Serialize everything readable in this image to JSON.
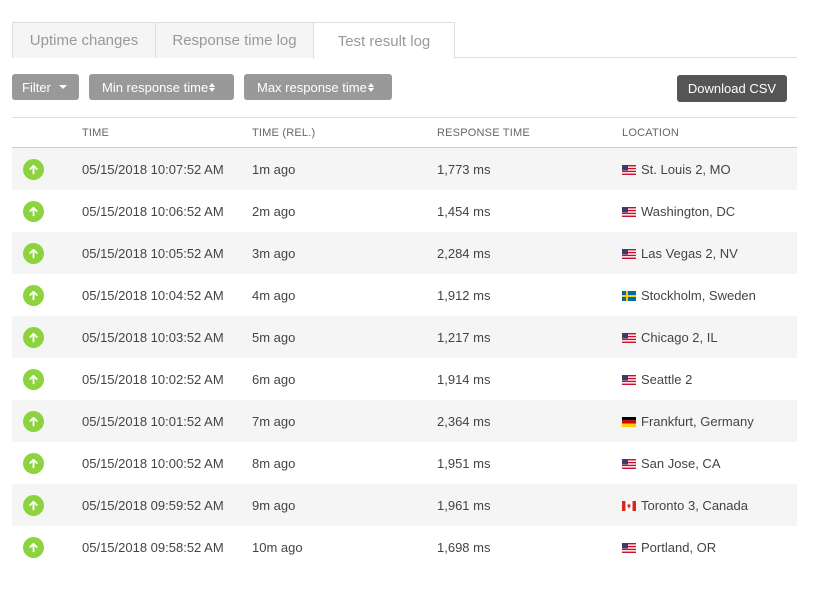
{
  "tabs": [
    {
      "label": "Uptime changes"
    },
    {
      "label": "Response time log"
    },
    {
      "label": "Test result log"
    }
  ],
  "toolbar": {
    "filter_label": "Filter",
    "min_label": "Min response time",
    "max_label": "Max response time",
    "csv_label": "Download CSV"
  },
  "table": {
    "headers": [
      "TIME",
      "TIME (REL.)",
      "RESPONSE TIME",
      "LOCATION"
    ],
    "rows": [
      {
        "status": "up",
        "time": "05/15/2018 10:07:52 AM",
        "rel": "1m ago",
        "response": "1,773 ms",
        "flag": "us",
        "location": "St. Louis 2, MO"
      },
      {
        "status": "up",
        "time": "05/15/2018 10:06:52 AM",
        "rel": "2m ago",
        "response": "1,454 ms",
        "flag": "us",
        "location": "Washington, DC"
      },
      {
        "status": "up",
        "time": "05/15/2018 10:05:52 AM",
        "rel": "3m ago",
        "response": "2,284 ms",
        "flag": "us",
        "location": "Las Vegas 2, NV"
      },
      {
        "status": "up",
        "time": "05/15/2018 10:04:52 AM",
        "rel": "4m ago",
        "response": "1,912 ms",
        "flag": "se",
        "location": "Stockholm, Sweden"
      },
      {
        "status": "up",
        "time": "05/15/2018 10:03:52 AM",
        "rel": "5m ago",
        "response": "1,217 ms",
        "flag": "us",
        "location": "Chicago 2, IL"
      },
      {
        "status": "up",
        "time": "05/15/2018 10:02:52 AM",
        "rel": "6m ago",
        "response": "1,914 ms",
        "flag": "us",
        "location": "Seattle 2"
      },
      {
        "status": "up",
        "time": "05/15/2018 10:01:52 AM",
        "rel": "7m ago",
        "response": "2,364 ms",
        "flag": "de",
        "location": "Frankfurt, Germany"
      },
      {
        "status": "up",
        "time": "05/15/2018 10:00:52 AM",
        "rel": "8m ago",
        "response": "1,951 ms",
        "flag": "us",
        "location": "San Jose, CA"
      },
      {
        "status": "up",
        "time": "05/15/2018 09:59:52 AM",
        "rel": "9m ago",
        "response": "1,961 ms",
        "flag": "ca",
        "location": "Toronto 3, Canada"
      },
      {
        "status": "up",
        "time": "05/15/2018 09:58:52 AM",
        "rel": "10m ago",
        "response": "1,698 ms",
        "flag": "us",
        "location": "Portland, OR"
      }
    ]
  },
  "colors": {
    "up": "#8cd33f",
    "button": "#999999",
    "button_dark": "#555555"
  }
}
